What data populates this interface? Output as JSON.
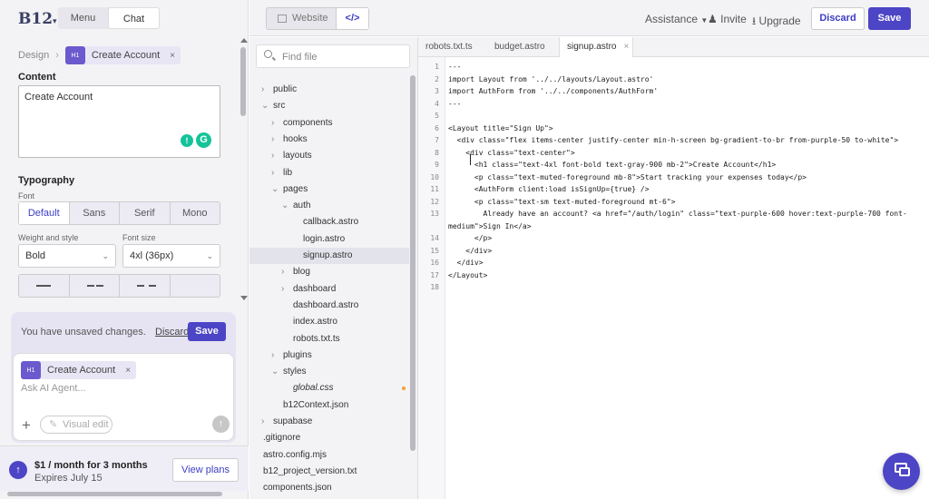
{
  "app": {
    "logo": "B12",
    "logo_caret": "▾"
  },
  "mode_switch": {
    "menu": "Menu",
    "chat": "Chat"
  },
  "breadcrumb": {
    "design": "Design",
    "sep": "›",
    "chip_tag": "H1",
    "chip_label": "Create Account",
    "chip_close": "×"
  },
  "content": {
    "label": "Content",
    "value": "Create Account"
  },
  "typography": {
    "label": "Typography",
    "font_label": "Font",
    "fonts": [
      "Default",
      "Sans",
      "Serif",
      "Mono"
    ],
    "weight_label": "Weight and style",
    "weight_value": "Bold",
    "size_label": "Font size",
    "size_value": "4xl (36px)"
  },
  "chat": {
    "unsaved": "You have unsaved changes.",
    "discard": "Discard",
    "save": "Save",
    "chip_tag": "H1",
    "chip_label": "Create Account",
    "chip_close": "×",
    "placeholder": "Ask AI Agent...",
    "plus": "+",
    "visual_edit": "Visual edit",
    "send": "↑"
  },
  "plan": {
    "title": "$1 / month for 3 months",
    "subtitle": "Expires July 15",
    "button": "View plans",
    "icon": "↑"
  },
  "topbar": {
    "website": "Website",
    "code": "</>",
    "assistance": "Assistance",
    "invite": "Invite",
    "upgrade": "Upgrade",
    "discard": "Discard",
    "save": "Save"
  },
  "tree": {
    "search_placeholder": "Find file",
    "items": [
      {
        "name": "public",
        "type": "folder",
        "depth": 0,
        "open": false
      },
      {
        "name": "src",
        "type": "folder",
        "depth": 0,
        "open": true
      },
      {
        "name": "components",
        "type": "folder",
        "depth": 1,
        "open": false
      },
      {
        "name": "hooks",
        "type": "folder",
        "depth": 1,
        "open": false
      },
      {
        "name": "layouts",
        "type": "folder",
        "depth": 1,
        "open": false
      },
      {
        "name": "lib",
        "type": "folder",
        "depth": 1,
        "open": false
      },
      {
        "name": "pages",
        "type": "folder",
        "depth": 1,
        "open": true
      },
      {
        "name": "auth",
        "type": "folder",
        "depth": 2,
        "open": true
      },
      {
        "name": "callback.astro",
        "type": "file",
        "depth": 3
      },
      {
        "name": "login.astro",
        "type": "file",
        "depth": 3
      },
      {
        "name": "signup.astro",
        "type": "file",
        "depth": 3,
        "selected": true
      },
      {
        "name": "blog",
        "type": "folder",
        "depth": 2,
        "open": false
      },
      {
        "name": "dashboard",
        "type": "folder",
        "depth": 2,
        "open": false
      },
      {
        "name": "dashboard.astro",
        "type": "file",
        "depth": 2
      },
      {
        "name": "index.astro",
        "type": "file",
        "depth": 2
      },
      {
        "name": "robots.txt.ts",
        "type": "file",
        "depth": 2
      },
      {
        "name": "plugins",
        "type": "folder",
        "depth": 1,
        "open": false
      },
      {
        "name": "styles",
        "type": "folder",
        "depth": 1,
        "open": true
      },
      {
        "name": "global.css",
        "type": "file",
        "depth": 2,
        "italic": true,
        "modified": true
      },
      {
        "name": "b12Context.json",
        "type": "file",
        "depth": 1
      },
      {
        "name": "supabase",
        "type": "folder",
        "depth": 0,
        "open": false
      },
      {
        "name": ".gitignore",
        "type": "file",
        "depth": 0
      },
      {
        "name": "astro.config.mjs",
        "type": "file",
        "depth": 0
      },
      {
        "name": "b12_project_version.txt",
        "type": "file",
        "depth": 0
      },
      {
        "name": "components.json",
        "type": "file",
        "depth": 0
      }
    ]
  },
  "editor": {
    "tabs": [
      {
        "label": "robots.txt.ts",
        "active": false
      },
      {
        "label": "budget.astro",
        "active": false
      },
      {
        "label": "signup.astro",
        "active": true,
        "close": "×"
      }
    ],
    "lines": [
      {
        "n": "1",
        "text": "---"
      },
      {
        "n": "2",
        "text": "import Layout from '../../layouts/Layout.astro'"
      },
      {
        "n": "3",
        "text": "import AuthForm from '../../components/AuthForm'"
      },
      {
        "n": "4",
        "text": "---"
      },
      {
        "n": "5",
        "text": ""
      },
      {
        "n": "6",
        "text": "<Layout title=\"Sign Up\">"
      },
      {
        "n": "7",
        "text": "  <div class=\"flex items-center justify-center min-h-screen bg-gradient-to-br from-purple-50 to-white\">"
      },
      {
        "n": "8",
        "text": "    <div class=\"text-center\">"
      },
      {
        "n": "9",
        "text": "      <h1 class=\"text-4xl font-bold text-gray-900 mb-2\">Create Account</h1>"
      },
      {
        "n": "10",
        "text": "      <p class=\"text-muted-foreground mb-8\">Start tracking your expenses today</p>"
      },
      {
        "n": "11",
        "text": "      <AuthForm client:load isSignUp={true} />"
      },
      {
        "n": "12",
        "text": "      <p class=\"text-sm text-muted-foreground mt-6\">"
      },
      {
        "n": "13",
        "text": "        Already have an account? <a href=\"/auth/login\" class=\"text-purple-600 hover:text-purple-700 font-"
      },
      {
        "n": "",
        "text": "medium\">Sign In</a>"
      },
      {
        "n": "14",
        "text": "      </p>"
      },
      {
        "n": "15",
        "text": "    </div>"
      },
      {
        "n": "16",
        "text": "  </div>"
      },
      {
        "n": "17",
        "text": "</Layout>"
      },
      {
        "n": "18",
        "text": ""
      }
    ]
  },
  "colors": {
    "accent": "#4c45c6",
    "panel": "#f3f3f6",
    "chip_tag": "#6a5acd",
    "grammarly": "#15c39a"
  }
}
